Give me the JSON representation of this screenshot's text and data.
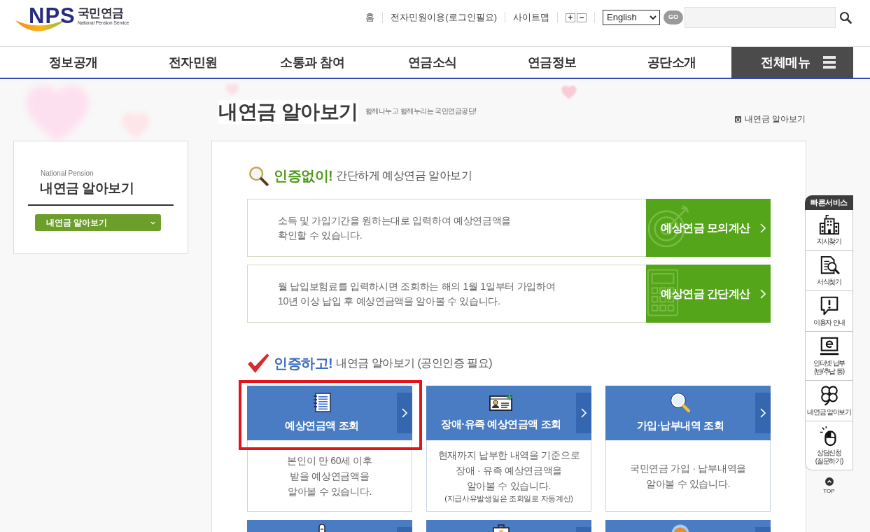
{
  "header": {
    "logo": {
      "abbr": "NPS",
      "name": "국민연금",
      "tagline": "National Pension Service"
    },
    "utility_links": [
      "홈",
      "전자민원이용(로그인필요)",
      "사이트맵"
    ],
    "font_size_buttons": [
      "+",
      "−"
    ],
    "language_select": {
      "value": "English"
    },
    "go_button": "GO"
  },
  "nav": {
    "items": [
      "정보공개",
      "전자민원",
      "소통과 참여",
      "연금소식",
      "연금정보",
      "공단소개"
    ],
    "all_menu_button": "전체메뉴"
  },
  "page_title": {
    "title": "내연금 알아보기",
    "slogan": "함께나누고 함께누리는 국민연금공단!",
    "breadcrumb": "내연금 알아보기"
  },
  "sidebar": {
    "caption": "National Pension",
    "title": "내연금 알아보기",
    "dropdown": {
      "value": "내연금 알아보기"
    }
  },
  "sections": [
    {
      "kind": "calculators",
      "emphasis": "인증없이!",
      "heading": "간단하게 예상연금 알아보기",
      "items": [
        {
          "description": "소득 및 가입기간을 원하는대로 입력하여 예상연금액을\n확인할 수 있습니다.",
          "button": "예상연금 모의계산"
        },
        {
          "description": "월 납입보험료를 입력하시면 조회하는 해의 1월 1일부터 가입하여\n10년 이상 납입 후 예상연금액을 알아볼 수 있습니다.",
          "button": "예상연금 간단계산"
        }
      ]
    },
    {
      "kind": "tiles",
      "emphasis": "인증하고!",
      "heading": "내연금 알아보기 (공인인증 필요)",
      "tiles": [
        {
          "title": "예상연금액 조회",
          "description": "본인이 만 60세 이후\n받을 예상연금액을\n알아볼 수 있습니다.",
          "highlighted": true
        },
        {
          "title": "장애·유족 예상연금액 조회",
          "description": "현재까지 납부한 내역을 기준으로\n장애 · 유족 예상연금액을\n알아볼 수 있습니다.",
          "note": "(지급사유발생일은 조회일로 자동계산)",
          "highlighted": false
        },
        {
          "title": "가입·납부내역 조회",
          "description": "국민연금 가입 · 납부내역을\n알아볼 수 있습니다.",
          "highlighted": false
        },
        {
          "highlighted": false
        },
        {
          "highlighted": false
        },
        {
          "highlighted": false
        }
      ]
    }
  ],
  "quick_service": {
    "title": "빠른서비스",
    "items": [
      "지사찾기",
      "서식찾기",
      "이용자 안내",
      "인터넷 납부\n(반/추납 등)",
      "내연금 알아보기",
      "상담신청\n(질문하기)"
    ],
    "top_button": "TOP"
  }
}
